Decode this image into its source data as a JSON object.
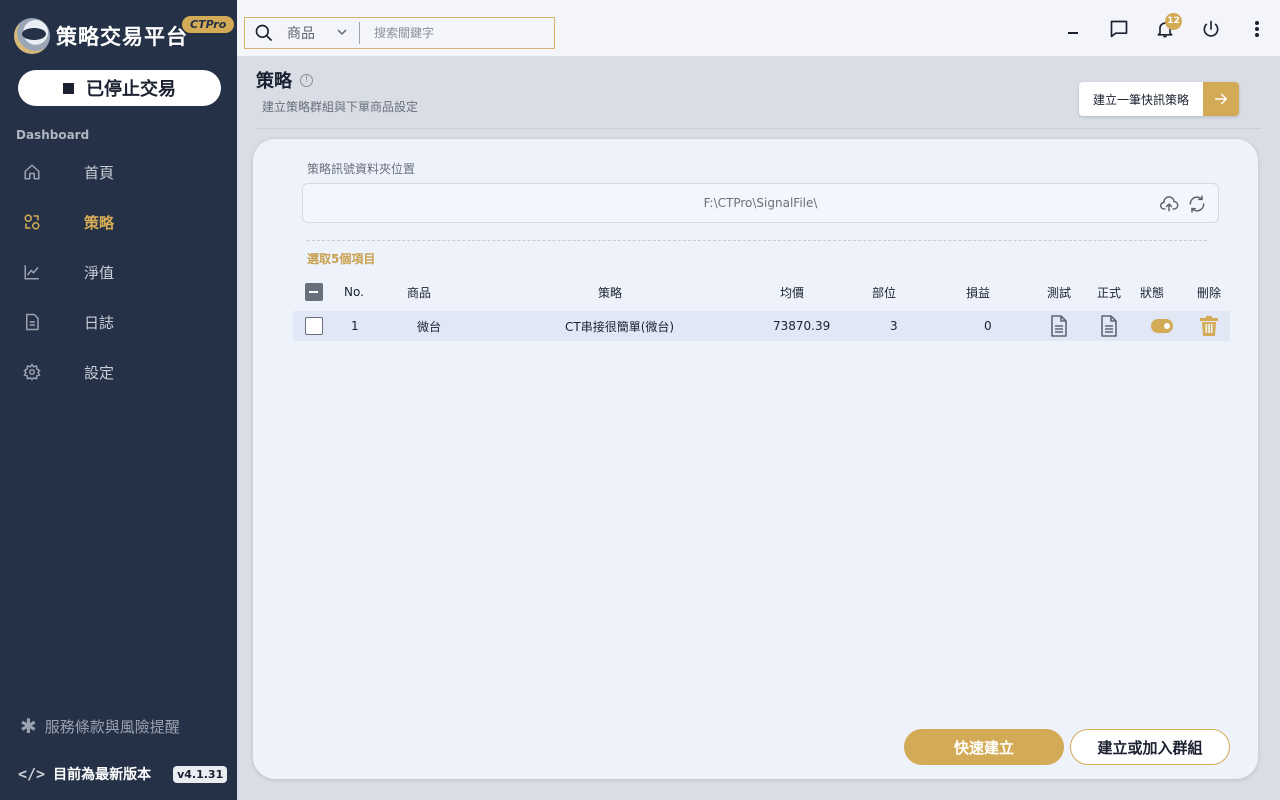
{
  "brand": {
    "title": "策略交易平台",
    "badge": "CTPro"
  },
  "trading_status": {
    "label": "已停止交易"
  },
  "sidebar": {
    "section_label": "Dashboard",
    "items": [
      {
        "label": "首頁",
        "icon": "home-icon"
      },
      {
        "label": "策略",
        "icon": "strategy-icon",
        "active": true
      },
      {
        "label": "淨值",
        "icon": "chart-line-icon"
      },
      {
        "label": "日誌",
        "icon": "document-icon"
      },
      {
        "label": "設定",
        "icon": "gear-icon"
      }
    ],
    "terms_label": "服務條款與風險提醒",
    "version_text": "目前為最新版本",
    "version_code": "</>",
    "version_badge": "v4.1.31"
  },
  "topbar": {
    "search_category": "商品",
    "search_placeholder": "搜索關鍵字",
    "notification_count": "12"
  },
  "page": {
    "title": "策略",
    "info_glyph": "!",
    "subtitle": "建立策略群組與下單商品設定",
    "quick_button_label": "建立一筆快訊策略"
  },
  "folder": {
    "label": "策略訊號資料夾位置",
    "path": "F:\\CTPro\\SignalFile\\"
  },
  "selection": {
    "label": "選取5個項目"
  },
  "table": {
    "headers": {
      "no": "No.",
      "product": "商品",
      "strategy": "策略",
      "avg_price": "均價",
      "position": "部位",
      "pnl": "損益",
      "test": "測試",
      "live": "正式",
      "status": "狀態",
      "delete": "刪除"
    },
    "rows": [
      {
        "no": "1",
        "product": "微台",
        "strategy": "CT串接很簡單(微台)",
        "avg_price": "73870.39",
        "position": "3",
        "pnl": "0",
        "status_on": true
      }
    ]
  },
  "actions": {
    "quick_create": "快速建立",
    "create_or_join": "建立或加入群組"
  },
  "colors": {
    "sidebar_bg": "#243146",
    "accent": "#d3aa55",
    "main_bg": "#d9dde5",
    "card_bg": "#eef2fb"
  }
}
